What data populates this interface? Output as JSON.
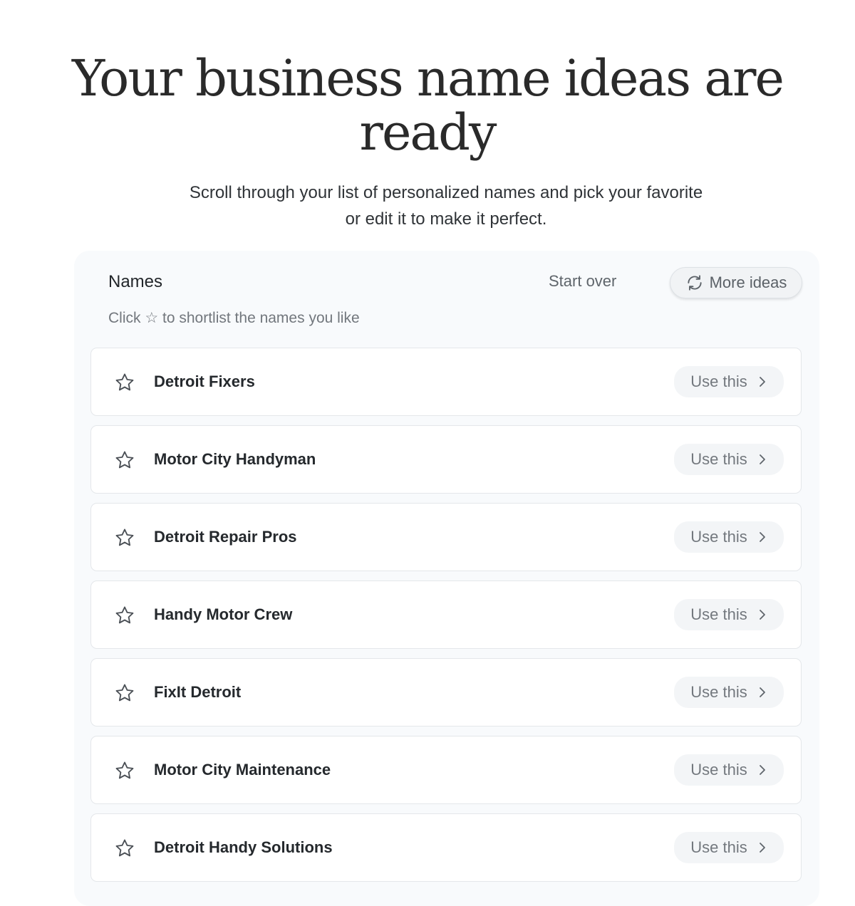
{
  "hero": {
    "title": "Your business name ideas are ready",
    "subtitle": "Scroll through your list of personalized names and pick your favorite or edit it to make it perfect."
  },
  "panel": {
    "title": "Names",
    "start_over_label": "Start over",
    "more_ideas_label": "More ideas",
    "more_ideas_icon": "refresh-icon",
    "hint_prefix": "Click",
    "hint_icon": "☆",
    "hint_suffix": "to shortlist the names you like"
  },
  "names": [
    {
      "name": "Detroit Fixers",
      "action": "Use this",
      "icon": "star-outline-icon"
    },
    {
      "name": "Motor City Handyman",
      "action": "Use this",
      "icon": "star-outline-icon"
    },
    {
      "name": "Detroit Repair Pros",
      "action": "Use this",
      "icon": "star-outline-icon"
    },
    {
      "name": "Handy Motor Crew",
      "action": "Use this",
      "icon": "star-outline-icon"
    },
    {
      "name": "FixIt Detroit",
      "action": "Use this",
      "icon": "star-outline-icon"
    },
    {
      "name": "Motor City Maintenance",
      "action": "Use this",
      "icon": "star-outline-icon"
    },
    {
      "name": "Detroit Handy Solutions",
      "action": "Use this",
      "icon": "star-outline-icon"
    }
  ]
}
